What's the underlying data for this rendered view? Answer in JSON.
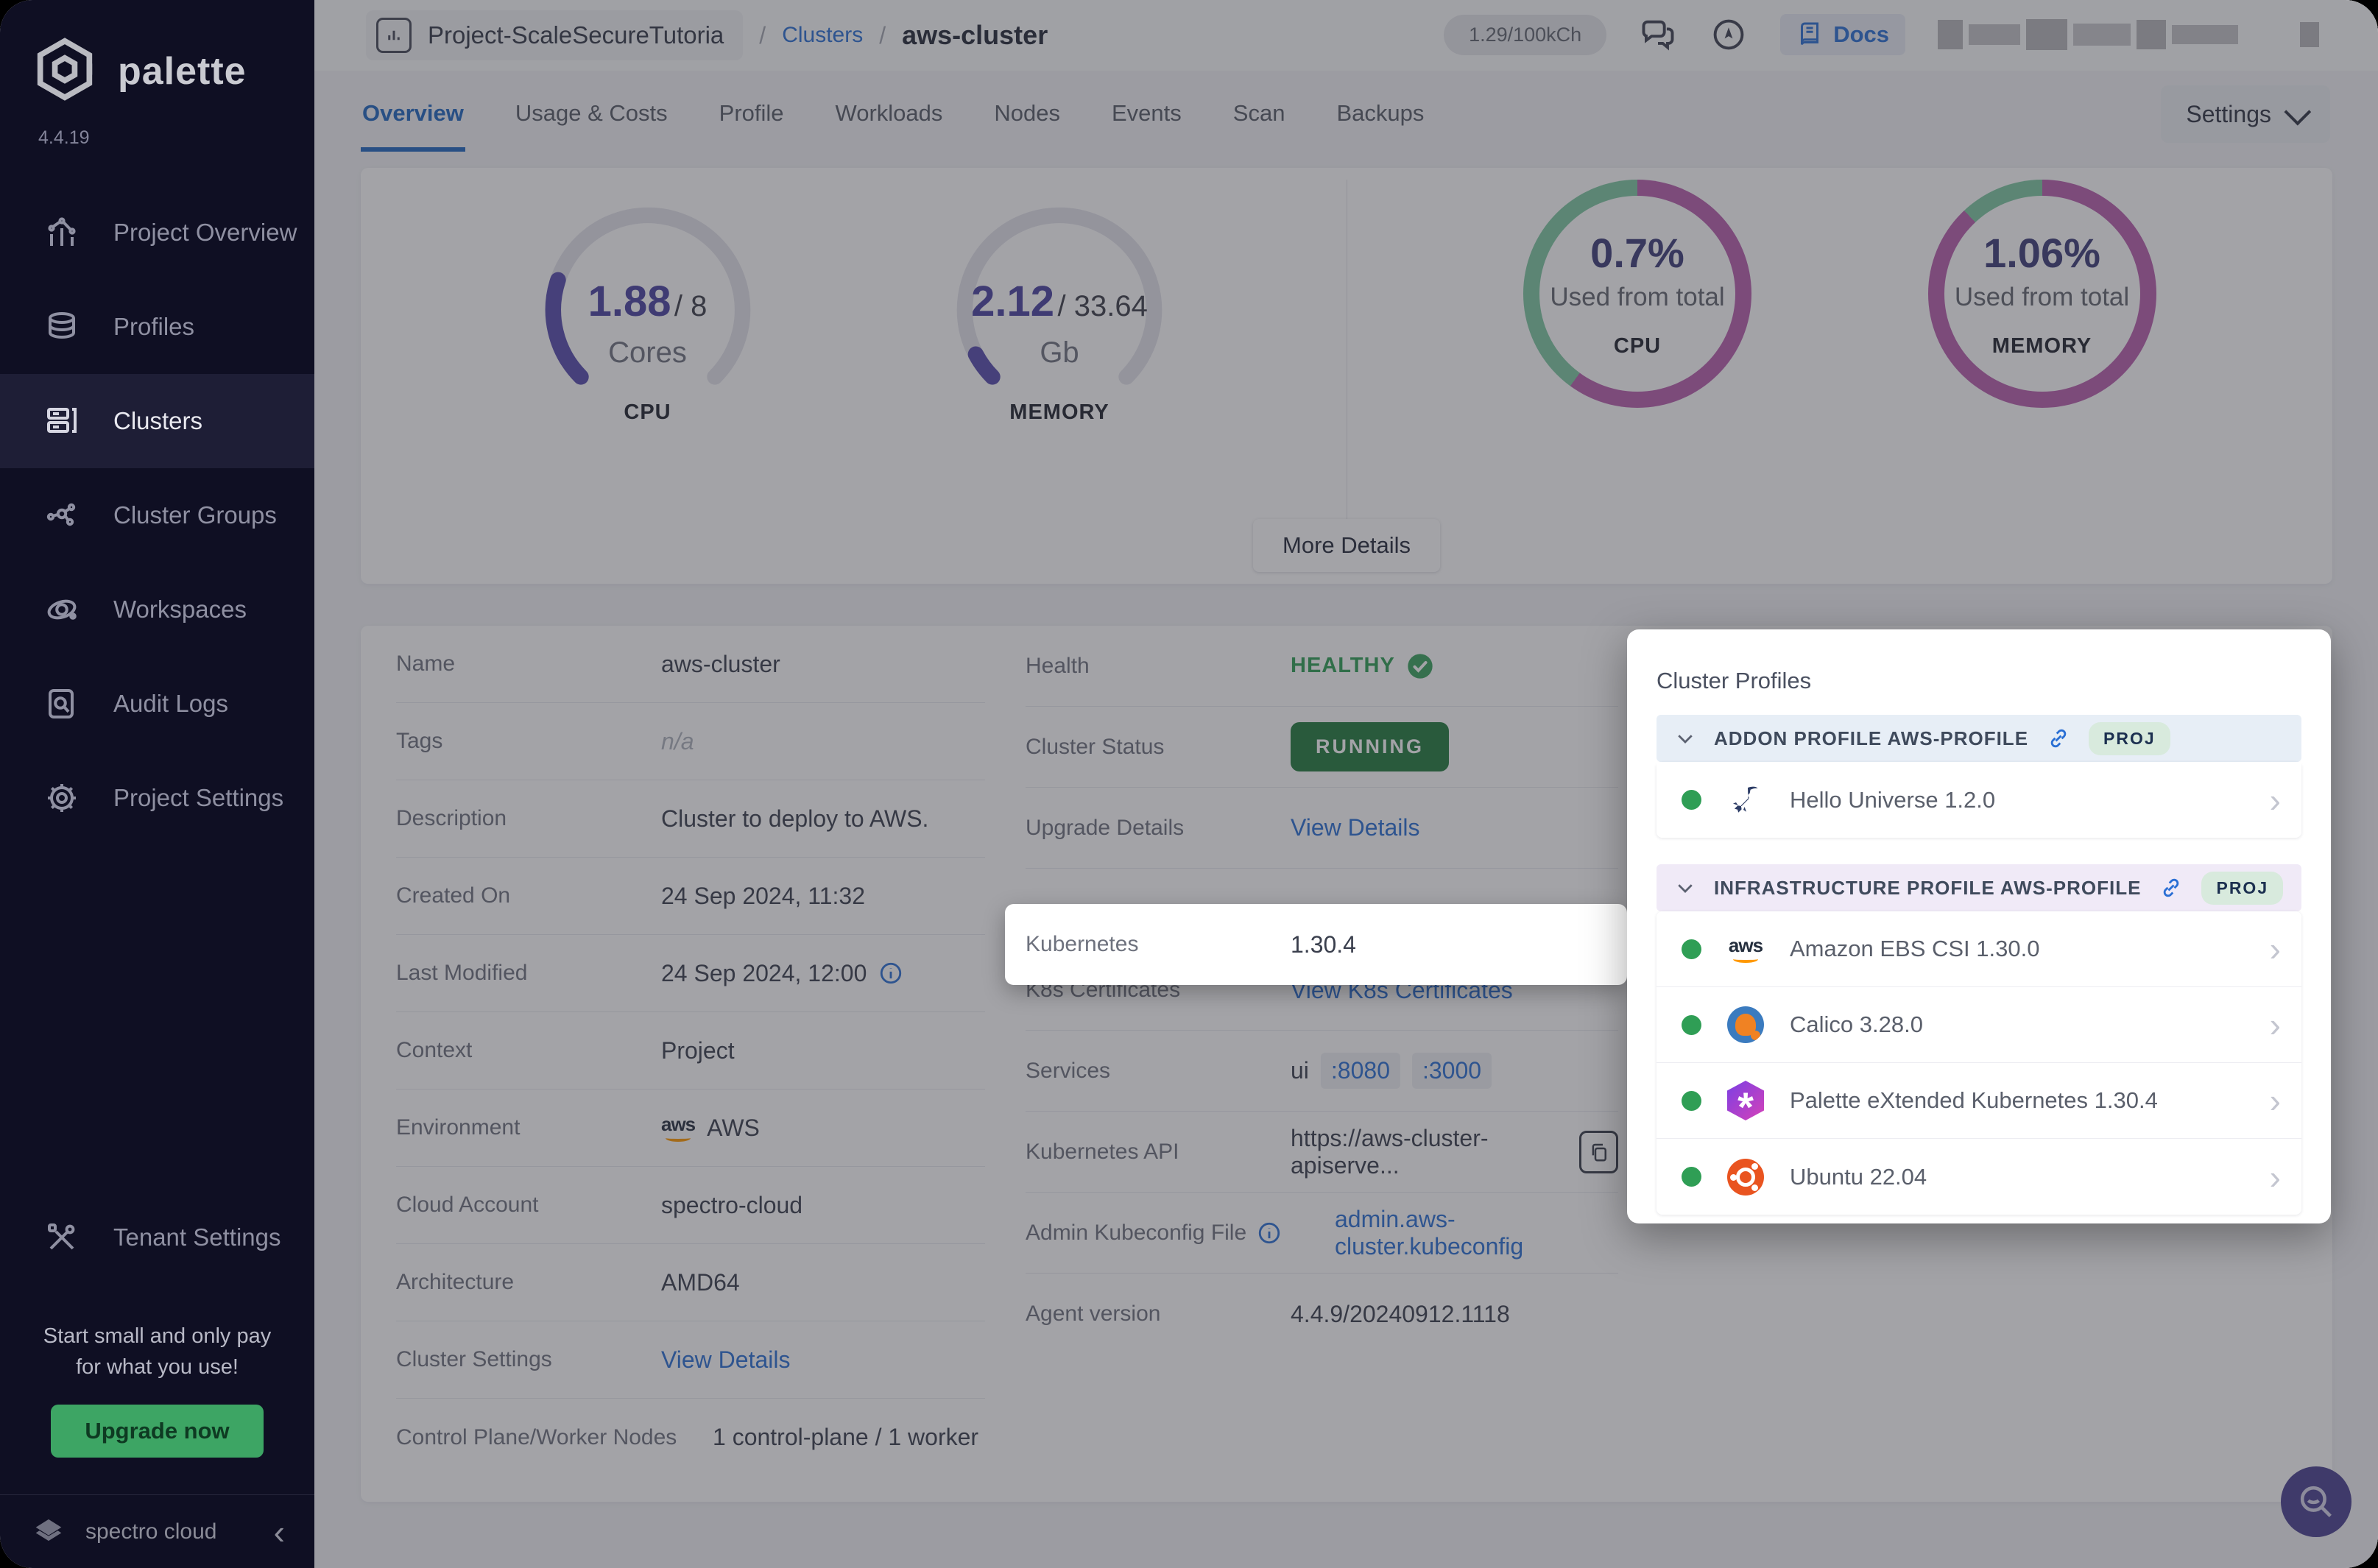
{
  "app": {
    "brand": "palette",
    "version": "4.4.19",
    "footer_brand": "spectro cloud"
  },
  "sidebar": {
    "items": [
      {
        "label": "Project Overview"
      },
      {
        "label": "Profiles"
      },
      {
        "label": "Clusters"
      },
      {
        "label": "Cluster Groups"
      },
      {
        "label": "Workspaces"
      },
      {
        "label": "Audit Logs"
      },
      {
        "label": "Project Settings"
      }
    ],
    "tenant_item": "Tenant Settings",
    "promo_line1": "Start small and only pay",
    "promo_line2": "for what you use!",
    "upgrade_label": "Upgrade now"
  },
  "header": {
    "project": "Project-ScaleSecureTutoria",
    "breadcrumb_section": "Clusters",
    "breadcrumb_current": "aws-cluster",
    "usage_badge": "1.29/100kCh",
    "docs_label": "Docs",
    "settings_label": "Settings"
  },
  "tabs": [
    {
      "label": "Overview"
    },
    {
      "label": "Usage & Costs"
    },
    {
      "label": "Profile"
    },
    {
      "label": "Workloads"
    },
    {
      "label": "Nodes"
    },
    {
      "label": "Events"
    },
    {
      "label": "Scan"
    },
    {
      "label": "Backups"
    }
  ],
  "metrics": {
    "cpu_gauge": {
      "value": "1.88",
      "total": "/ 8",
      "unit": "Cores",
      "label": "CPU"
    },
    "memory_gauge": {
      "value": "2.12",
      "total": "/ 33.64",
      "unit": "Gb",
      "label": "MEMORY"
    },
    "cpu_donut": {
      "value": "0.7%",
      "caption": "Used from total",
      "label": "CPU"
    },
    "memory_donut": {
      "value": "1.06%",
      "caption": "Used from total",
      "label": "MEMORY"
    },
    "more_details_label": "More Details"
  },
  "details": {
    "left": [
      {
        "label": "Name",
        "value": "aws-cluster"
      },
      {
        "label": "Tags",
        "value": "n/a"
      },
      {
        "label": "Description",
        "value": "Cluster to deploy to AWS."
      },
      {
        "label": "Created On",
        "value": "24 Sep 2024, 11:32"
      },
      {
        "label": "Last Modified",
        "value": "24 Sep 2024, 12:00"
      },
      {
        "label": "Context",
        "value": "Project"
      },
      {
        "label": "Environment",
        "value": "AWS"
      },
      {
        "label": "Cloud Account",
        "value": "spectro-cloud"
      },
      {
        "label": "Architecture",
        "value": "AMD64"
      },
      {
        "label": "Cluster Settings",
        "value": "View Details"
      },
      {
        "label": "Control Plane/Worker Nodes",
        "value": "1 control-plane / 1 worker"
      }
    ],
    "right": {
      "health_label": "Health",
      "health_value": "HEALTHY",
      "status_label": "Cluster Status",
      "status_value": "RUNNING",
      "upgrade_label": "Upgrade Details",
      "upgrade_value": "View Details",
      "kubernetes_label": "Kubernetes",
      "kubernetes_value": "1.30.4",
      "certs_label": "K8s Certificates",
      "certs_value": "View K8s Certificates",
      "services_label": "Services",
      "services_prefix": "ui",
      "services_port1": ":8080",
      "services_port2": ":3000",
      "api_label": "Kubernetes API",
      "api_value": "https://aws-cluster-apiserve...",
      "kubeconfig_label": "Admin Kubeconfig File",
      "kubeconfig_value": "admin.aws-cluster.kubeconfig",
      "agent_label": "Agent version",
      "agent_value": "4.4.9/20240912.1118"
    }
  },
  "popup": {
    "title": "Cluster Profiles",
    "sections": [
      {
        "header": "ADDON PROFILE AWS-PROFILE",
        "badge": "PROJ",
        "items": [
          {
            "name": "Hello Universe 1.2.0"
          }
        ]
      },
      {
        "header": "INFRASTRUCTURE PROFILE AWS-PROFILE",
        "badge": "PROJ",
        "items": [
          {
            "name": "Amazon EBS CSI 1.30.0"
          },
          {
            "name": "Calico 3.28.0"
          },
          {
            "name": "Palette eXtended Kubernetes 1.30.4"
          },
          {
            "name": "Ubuntu 22.04"
          }
        ]
      }
    ]
  },
  "colors": {
    "accent_blue": "#2a6fd4",
    "status_green": "#2f9e55",
    "running_bg": "#217a3c",
    "donut_green": "#7fc8a2",
    "donut_magenta": "#b85fae",
    "gauge_purple": "#564cae",
    "fab_purple": "#4a4190"
  }
}
